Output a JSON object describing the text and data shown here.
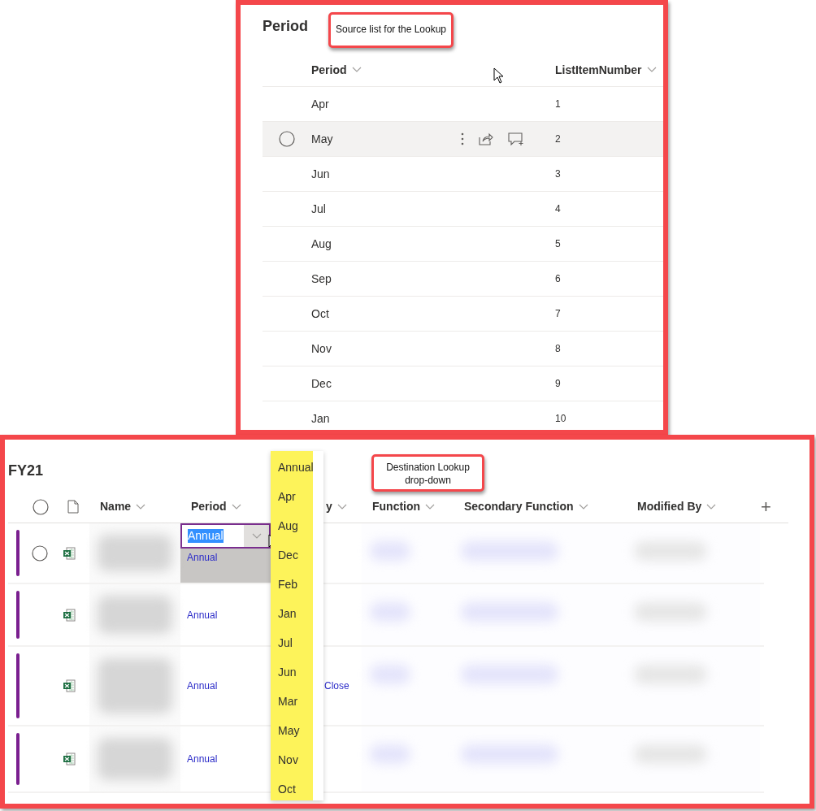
{
  "source_list": {
    "title": "Period",
    "callout": "Source list for the Lookup",
    "columns": [
      "Period",
      "ListItemNumber"
    ],
    "rows": [
      {
        "period": "Apr",
        "number": "1",
        "hovered": false
      },
      {
        "period": "May",
        "number": "2",
        "hovered": true
      },
      {
        "period": "Jun",
        "number": "3",
        "hovered": false
      },
      {
        "period": "Jul",
        "number": "4",
        "hovered": false
      },
      {
        "period": "Aug",
        "number": "5",
        "hovered": false
      },
      {
        "period": "Sep",
        "number": "6",
        "hovered": false
      },
      {
        "period": "Oct",
        "number": "7",
        "hovered": false
      },
      {
        "period": "Nov",
        "number": "8",
        "hovered": false
      },
      {
        "period": "Dec",
        "number": "9",
        "hovered": false
      },
      {
        "period": "Jan",
        "number": "10",
        "hovered": false
      }
    ]
  },
  "destination_list": {
    "title": "FY21",
    "callout": "Destination Lookup drop-down",
    "add_column": "+",
    "columns": [
      "Name",
      "Period",
      "y",
      "Function",
      "Secondary Function",
      "Modified By"
    ],
    "rows": [
      {
        "period": "Annual",
        "hovered": true,
        "editing": true,
        "edit_value": "Annual"
      },
      {
        "period": "Annual",
        "hovered": false,
        "editing": false
      },
      {
        "period": "Annual",
        "column_3": "Close",
        "hovered": false,
        "editing": false
      },
      {
        "period": "Annual",
        "hovered": false,
        "editing": false
      }
    ],
    "dropdown": {
      "highlighted": true,
      "options": [
        "Annual",
        "Apr",
        "Aug",
        "Dec",
        "Feb",
        "Jan",
        "Jul",
        "Jun",
        "Mar",
        "May",
        "Nov",
        "Oct"
      ]
    }
  }
}
